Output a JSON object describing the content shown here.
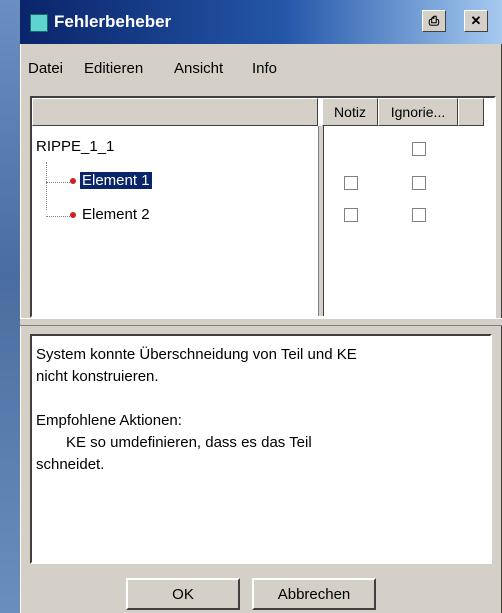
{
  "window": {
    "title": "Fehlerbeheber"
  },
  "titlebar": {
    "print_icon": "⎙",
    "close_icon": "✕"
  },
  "menu": {
    "items": [
      "Datei",
      "Editieren",
      "Ansicht",
      "Info"
    ]
  },
  "table": {
    "columns": [
      "Notiz",
      "Ignorie..."
    ],
    "root": "RIPPE_1_1",
    "elements": [
      {
        "label": "Element 1",
        "selected": true
      },
      {
        "label": "Element 2",
        "selected": false
      }
    ]
  },
  "message": {
    "line1": "System konnte Überschneidung von Teil und KE",
    "line2": "nicht konstruieren.",
    "heading": "Empfohlene Aktionen:",
    "action1": "KE so umdefinieren, dass es das Teil",
    "action2": "schneidet."
  },
  "buttons": {
    "ok": "OK",
    "cancel": "Abbrechen"
  },
  "colors": {
    "title_start": "#0a246a",
    "title_end": "#a6caf0",
    "dot": "#d02020",
    "selection": "#0a246a"
  }
}
